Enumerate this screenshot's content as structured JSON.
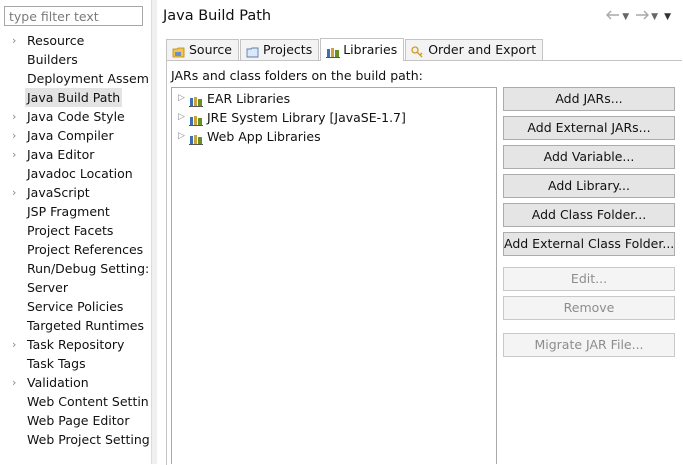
{
  "filter": {
    "placeholder": "type filter text"
  },
  "nav": {
    "items": [
      {
        "label": "Resource",
        "expandable": true
      },
      {
        "label": "Builders",
        "expandable": false
      },
      {
        "label": "Deployment Assem",
        "expandable": false
      },
      {
        "label": "Java Build Path",
        "expandable": false,
        "selected": true
      },
      {
        "label": "Java Code Style",
        "expandable": true
      },
      {
        "label": "Java Compiler",
        "expandable": true
      },
      {
        "label": "Java Editor",
        "expandable": true
      },
      {
        "label": "Javadoc Location",
        "expandable": false
      },
      {
        "label": "JavaScript",
        "expandable": true
      },
      {
        "label": "JSP Fragment",
        "expandable": false
      },
      {
        "label": "Project Facets",
        "expandable": false
      },
      {
        "label": "Project References",
        "expandable": false
      },
      {
        "label": "Run/Debug Setting:",
        "expandable": false
      },
      {
        "label": "Server",
        "expandable": false
      },
      {
        "label": "Service Policies",
        "expandable": false
      },
      {
        "label": "Targeted Runtimes",
        "expandable": false
      },
      {
        "label": "Task Repository",
        "expandable": true
      },
      {
        "label": "Task Tags",
        "expandable": false
      },
      {
        "label": "Validation",
        "expandable": true
      },
      {
        "label": "Web Content Settin",
        "expandable": false
      },
      {
        "label": "Web Page Editor",
        "expandable": false
      },
      {
        "label": "Web Project Setting",
        "expandable": false
      }
    ]
  },
  "header": {
    "title": "Java Build Path",
    "nav_icons": [
      "back-arrow-icon",
      "dropdown-icon",
      "forward-arrow-icon",
      "dropdown-icon",
      "view-menu-icon"
    ]
  },
  "tabs": [
    {
      "label": "Source",
      "icon": "source-folder-icon",
      "active": false
    },
    {
      "label": "Projects",
      "icon": "projects-icon",
      "active": false
    },
    {
      "label": "Libraries",
      "icon": "libraries-icon",
      "active": true
    },
    {
      "label": "Order and Export",
      "icon": "order-export-icon",
      "active": false
    }
  ],
  "libraries": {
    "description": "JARs and class folders on the build path:",
    "items": [
      {
        "label": "EAR Libraries",
        "icon": "library-icon"
      },
      {
        "label": "JRE System Library [JavaSE-1.7]",
        "icon": "library-icon"
      },
      {
        "label": "Web App Libraries",
        "icon": "library-icon"
      }
    ]
  },
  "buttons": [
    {
      "label": "Add JARs...",
      "enabled": true
    },
    {
      "label": "Add External JARs...",
      "enabled": true
    },
    {
      "label": "Add Variable...",
      "enabled": true
    },
    {
      "label": "Add Library...",
      "enabled": true
    },
    {
      "label": "Add Class Folder...",
      "enabled": true
    },
    {
      "label": "Add External Class Folder...",
      "enabled": true
    },
    {
      "label": "Edit...",
      "enabled": false
    },
    {
      "label": "Remove",
      "enabled": false
    },
    {
      "label": "Migrate JAR File...",
      "enabled": false
    }
  ],
  "colors": {
    "selection": "#e3e3e3",
    "button_face": "#e5e5e5",
    "disabled_text": "#8d8d8d",
    "tab_border": "#c4c4c4"
  }
}
